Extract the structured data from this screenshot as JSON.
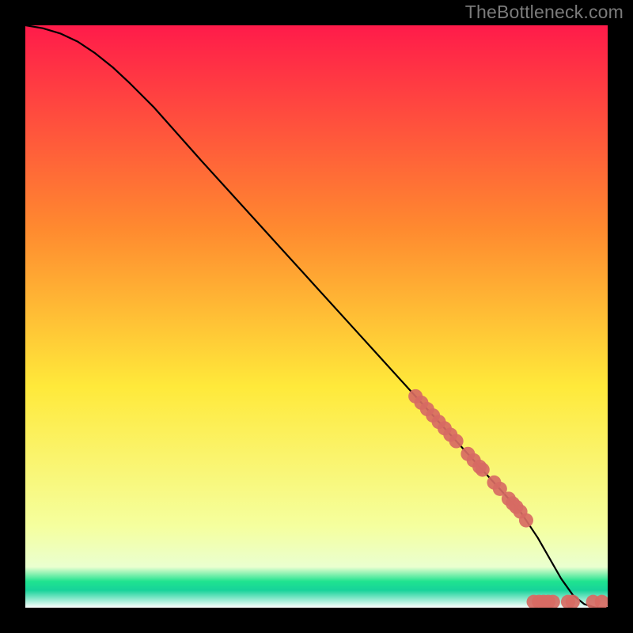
{
  "watermark": "TheBottleneck.com",
  "colors": {
    "gradient_top": "#ff1b4a",
    "gradient_mid_upper": "#ff8a2f",
    "gradient_mid": "#ffe93a",
    "gradient_mid_lower": "#f5ff9e",
    "gradient_band": "#1fe38f",
    "gradient_bottom": "#ffffff",
    "curve": "#000000",
    "point": "#d76a63",
    "point_stroke": "#d76a63"
  },
  "chart_data": {
    "type": "line",
    "title": "",
    "xlabel": "",
    "ylabel": "",
    "xlim": [
      0,
      100
    ],
    "ylim": [
      0,
      100
    ],
    "curve": {
      "x": [
        0,
        3,
        6,
        9,
        12,
        15,
        18,
        22,
        26,
        30,
        35,
        40,
        45,
        50,
        55,
        60,
        65,
        70,
        75,
        80,
        85,
        88,
        90,
        92,
        94,
        96,
        98,
        100
      ],
      "y": [
        100,
        99.5,
        98.6,
        97.2,
        95.2,
        92.8,
        90.0,
        86.0,
        81.5,
        77.0,
        71.5,
        66.0,
        60.5,
        55.0,
        49.5,
        44.0,
        38.5,
        33.0,
        27.5,
        22.0,
        16.5,
        12.0,
        8.5,
        5.0,
        2.2,
        0.6,
        0.0,
        0.0
      ]
    },
    "points": [
      {
        "x": 67,
        "y": 36.3
      },
      {
        "x": 68,
        "y": 35.2
      },
      {
        "x": 69,
        "y": 34.1
      },
      {
        "x": 70,
        "y": 33.0
      },
      {
        "x": 71,
        "y": 31.9
      },
      {
        "x": 72,
        "y": 30.8
      },
      {
        "x": 73,
        "y": 29.7
      },
      {
        "x": 74,
        "y": 28.6
      },
      {
        "x": 76,
        "y": 26.4
      },
      {
        "x": 77,
        "y": 25.3
      },
      {
        "x": 78,
        "y": 24.2
      },
      {
        "x": 78.5,
        "y": 23.7
      },
      {
        "x": 80.5,
        "y": 21.5
      },
      {
        "x": 81.5,
        "y": 20.4
      },
      {
        "x": 83,
        "y": 18.7
      },
      {
        "x": 83.7,
        "y": 17.9
      },
      {
        "x": 84.3,
        "y": 17.3
      },
      {
        "x": 85,
        "y": 16.5
      },
      {
        "x": 86,
        "y": 15.0
      },
      {
        "x": 87.3,
        "y": 1.0
      },
      {
        "x": 88.2,
        "y": 1.0
      },
      {
        "x": 89,
        "y": 1.0
      },
      {
        "x": 89.8,
        "y": 1.0
      },
      {
        "x": 90.6,
        "y": 1.0
      },
      {
        "x": 93.2,
        "y": 1.0
      },
      {
        "x": 94,
        "y": 1.0
      },
      {
        "x": 97.5,
        "y": 1.0
      },
      {
        "x": 99,
        "y": 1.0
      }
    ]
  }
}
